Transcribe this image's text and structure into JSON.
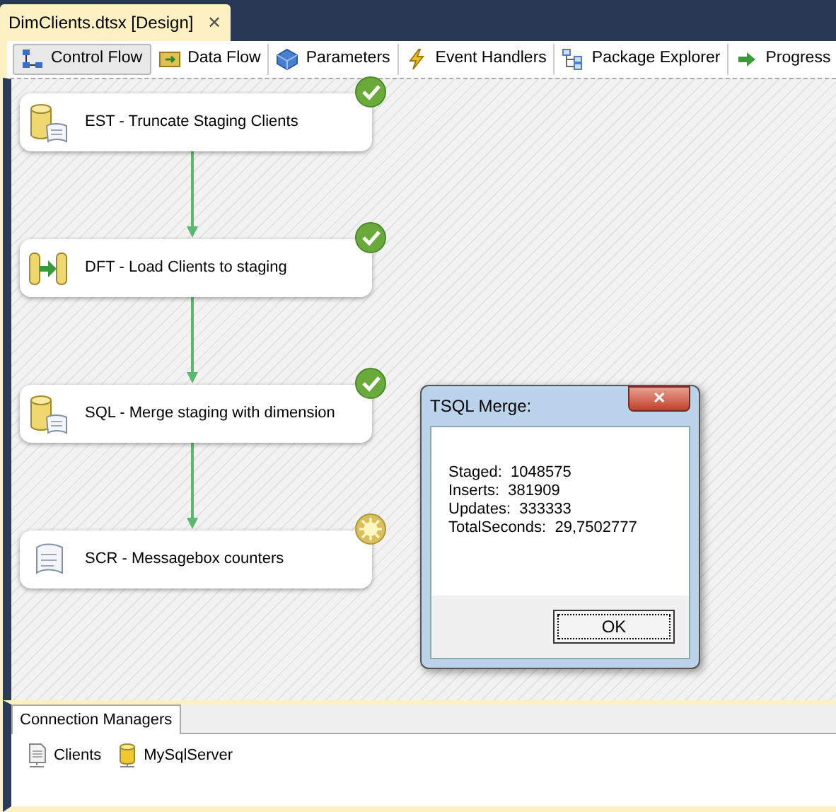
{
  "document_tab": {
    "title": "DimClients.dtsx [Design]",
    "close": "✕"
  },
  "designer_tabs": [
    {
      "label": "Control Flow",
      "selected": true
    },
    {
      "label": "Data Flow",
      "selected": false
    },
    {
      "label": "Parameters",
      "selected": false
    },
    {
      "label": "Event Handlers",
      "selected": false
    },
    {
      "label": "Package Explorer",
      "selected": false
    },
    {
      "label": "Progress",
      "selected": false
    }
  ],
  "tasks": [
    {
      "kind": "sql",
      "name": "EST - Truncate Staging Clients",
      "completed": true
    },
    {
      "kind": "dataflow",
      "name": "DFT - Load Clients to staging",
      "completed": true
    },
    {
      "kind": "sql",
      "name": "SQL - Merge staging with dimension",
      "completed": true
    },
    {
      "kind": "script",
      "name": "SCR - Messagebox counters",
      "completed": false
    }
  ],
  "message_box": {
    "title": "TSQL Merge:",
    "close": "✕",
    "lines": [
      {
        "label": "Staged:",
        "value": "1048575"
      },
      {
        "label": "Inserts:",
        "value": "381909"
      },
      {
        "label": "Updates:",
        "value": "333333"
      },
      {
        "label": "TotalSeconds:",
        "value": "29,7502777"
      }
    ],
    "button": "OK"
  },
  "connection_managers": {
    "tab": "Connection Managers",
    "items": [
      {
        "kind": "file",
        "name": "Clients"
      },
      {
        "kind": "database",
        "name": "MySqlServer"
      }
    ]
  }
}
